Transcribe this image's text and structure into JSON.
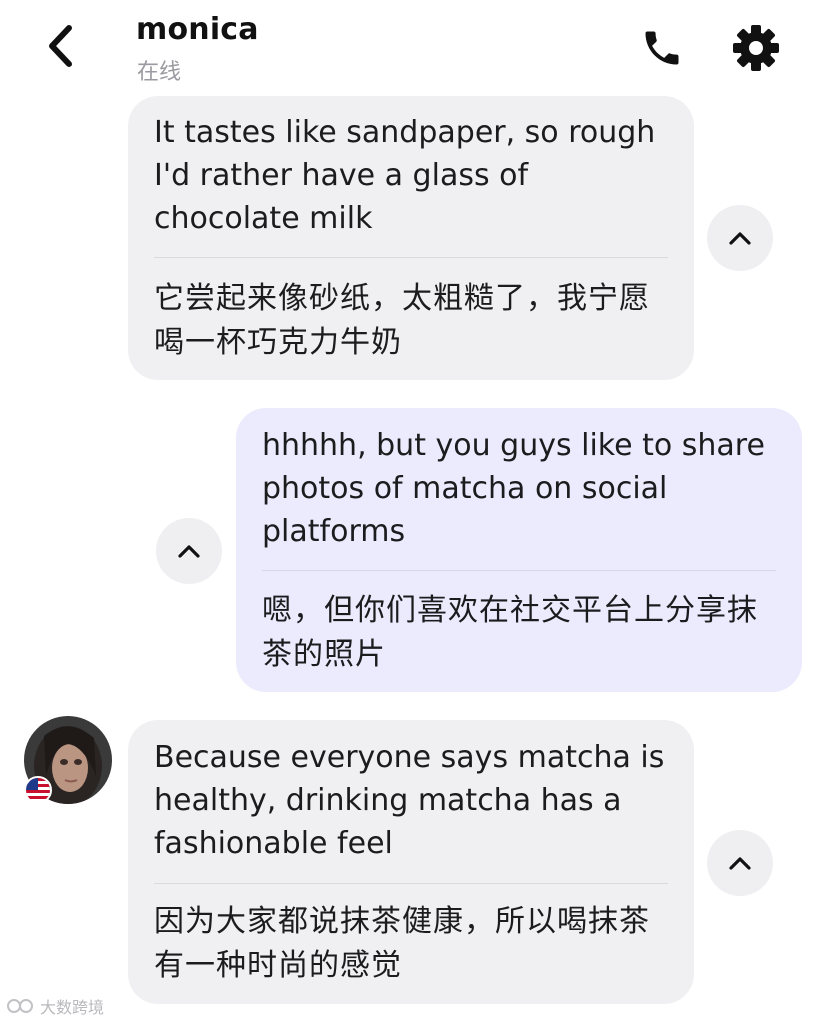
{
  "header": {
    "back_icon": "chevron-left-icon",
    "contact_name": "monica",
    "status": "在线",
    "call_icon": "phone-icon",
    "settings_icon": "gear-icon"
  },
  "messages": [
    {
      "direction": "received",
      "text_en": "It tastes like sandpaper, so rough I'd rather have a glass of chocolate milk",
      "text_zh": "它尝起来像砂纸，太粗糙了，我宁愿喝一杯巧克力牛奶"
    },
    {
      "direction": "sent",
      "text_en": "hhhhh, but you guys like to share photos of matcha on social platforms",
      "text_zh": "嗯，但你们喜欢在社交平台上分享抹茶的照片"
    },
    {
      "direction": "received",
      "text_en": "Because everyone says matcha is healthy, drinking matcha has a fashionable feel",
      "text_zh": "因为大家都说抹茶健康，所以喝抹茶有一种时尚的感觉"
    }
  ],
  "avatar": {
    "flag": "us-flag-icon"
  },
  "watermark": "大数跨境",
  "colors": {
    "received_bubble": "#f0f0f3",
    "sent_bubble": "#ecebfd",
    "status_text": "#9a9aa0"
  }
}
